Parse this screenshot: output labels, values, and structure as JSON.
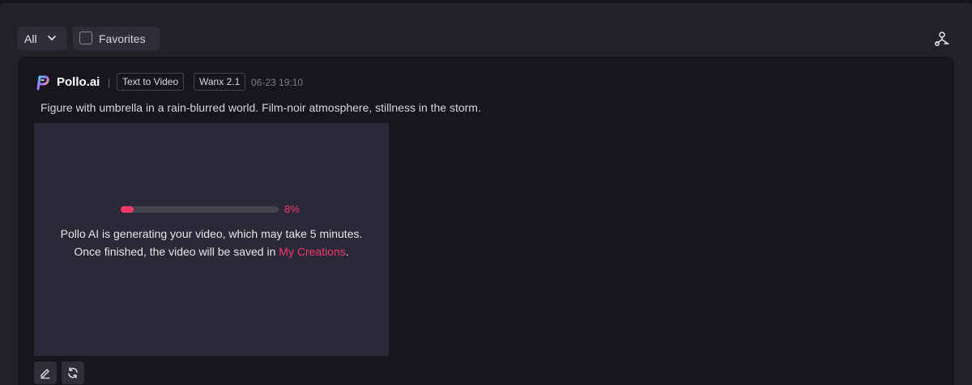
{
  "filters": {
    "category_selected": "All",
    "favorites_label": "Favorites",
    "favorites_checked": false
  },
  "header_icons": {
    "share": "share-icon"
  },
  "card": {
    "brand": "Pollo.ai",
    "separator": "|",
    "tags": [
      "Text to Video",
      "Wanx 2.1"
    ],
    "timestamp": "06-23 19:10",
    "prompt": "Figure with umbrella in a rain-blurred world. Film-noir atmosphere, stillness in the storm.",
    "progress": {
      "percent": 8,
      "label": "8%"
    },
    "message": {
      "text": "Pollo AI is generating your video, which may take 5 minutes. Once finished, the video will be saved in ",
      "link": "My Creations",
      "end": "."
    },
    "actions": [
      "edit-icon",
      "regenerate-icon"
    ]
  },
  "colors": {
    "accent": "#f0396a",
    "background": "#151419",
    "panel": "#232229",
    "card": "#17161c",
    "preview": "#2b2938"
  }
}
